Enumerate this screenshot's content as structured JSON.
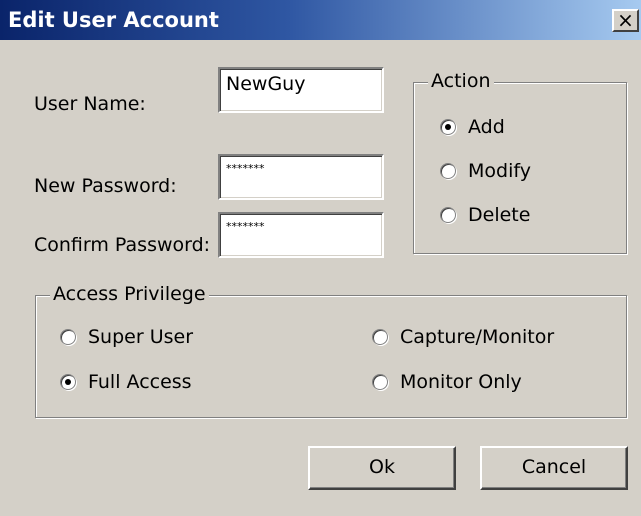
{
  "window": {
    "title": "Edit User Account",
    "close_glyph": "×"
  },
  "fields": {
    "user_name_label": "User Name:",
    "user_name_value": "NewGuy",
    "new_password_label": "New Password:",
    "new_password_value": "*******",
    "confirm_password_label": "Confirm Password:",
    "confirm_password_value": "*******"
  },
  "action_group": {
    "title": "Action",
    "options": [
      {
        "label": "Add",
        "checked": true
      },
      {
        "label": "Modify",
        "checked": false
      },
      {
        "label": "Delete",
        "checked": false
      }
    ]
  },
  "access_group": {
    "title": "Access Privilege",
    "options": [
      {
        "label": "Super User",
        "checked": false
      },
      {
        "label": "Full Access",
        "checked": true
      },
      {
        "label": "Capture/Monitor",
        "checked": false
      },
      {
        "label": "Monitor Only",
        "checked": false
      }
    ]
  },
  "buttons": {
    "ok": "Ok",
    "cancel": "Cancel"
  },
  "icons": {
    "close": "close-icon",
    "radio_checked": "radio-dot-icon"
  },
  "colors": {
    "title_start": "#0a246a",
    "title_end": "#a6caf0",
    "face": "#d4d0c8"
  }
}
